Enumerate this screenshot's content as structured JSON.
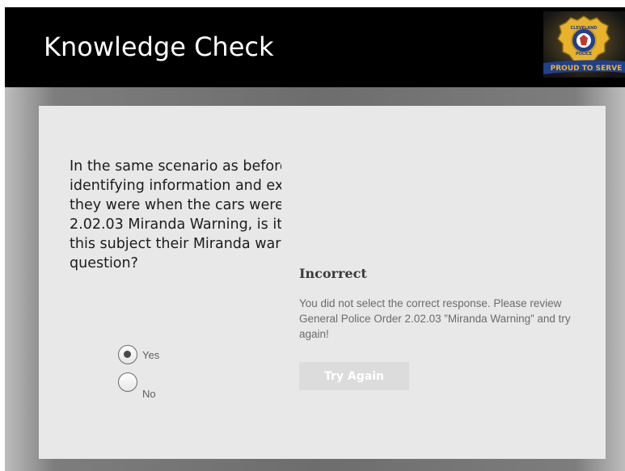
{
  "slide": {
    "title": "Knowledge Check",
    "badge_text": "PROUD TO SERVE",
    "badge_top_text": "CLEVELAND",
    "badge_bottom_text": "POLICE"
  },
  "question": {
    "text": "In the same scenario as before, the subject has given his\nidentifying information and explained where and what\nthey were when the cars were broken into. According to\n2.02.03 Miranda Warning, is it necessary to read\nthis subject their Miranda warnings before the next\nquestion?"
  },
  "choices": [
    {
      "label": "Yes",
      "selected": true
    },
    {
      "label": "No",
      "selected": false
    }
  ],
  "feedback": {
    "title": "Incorrect",
    "message": "You did not select the correct response. Please review General Police Order 2.02.03 ”Miranda Warning” and try again!",
    "button_label": "Try Again"
  },
  "colors": {
    "header": "#000000",
    "panel": "#e8e8e8",
    "button": "#dcdcdc",
    "badge_gold": "#e8b22a",
    "badge_blue": "#1f3f8f"
  }
}
